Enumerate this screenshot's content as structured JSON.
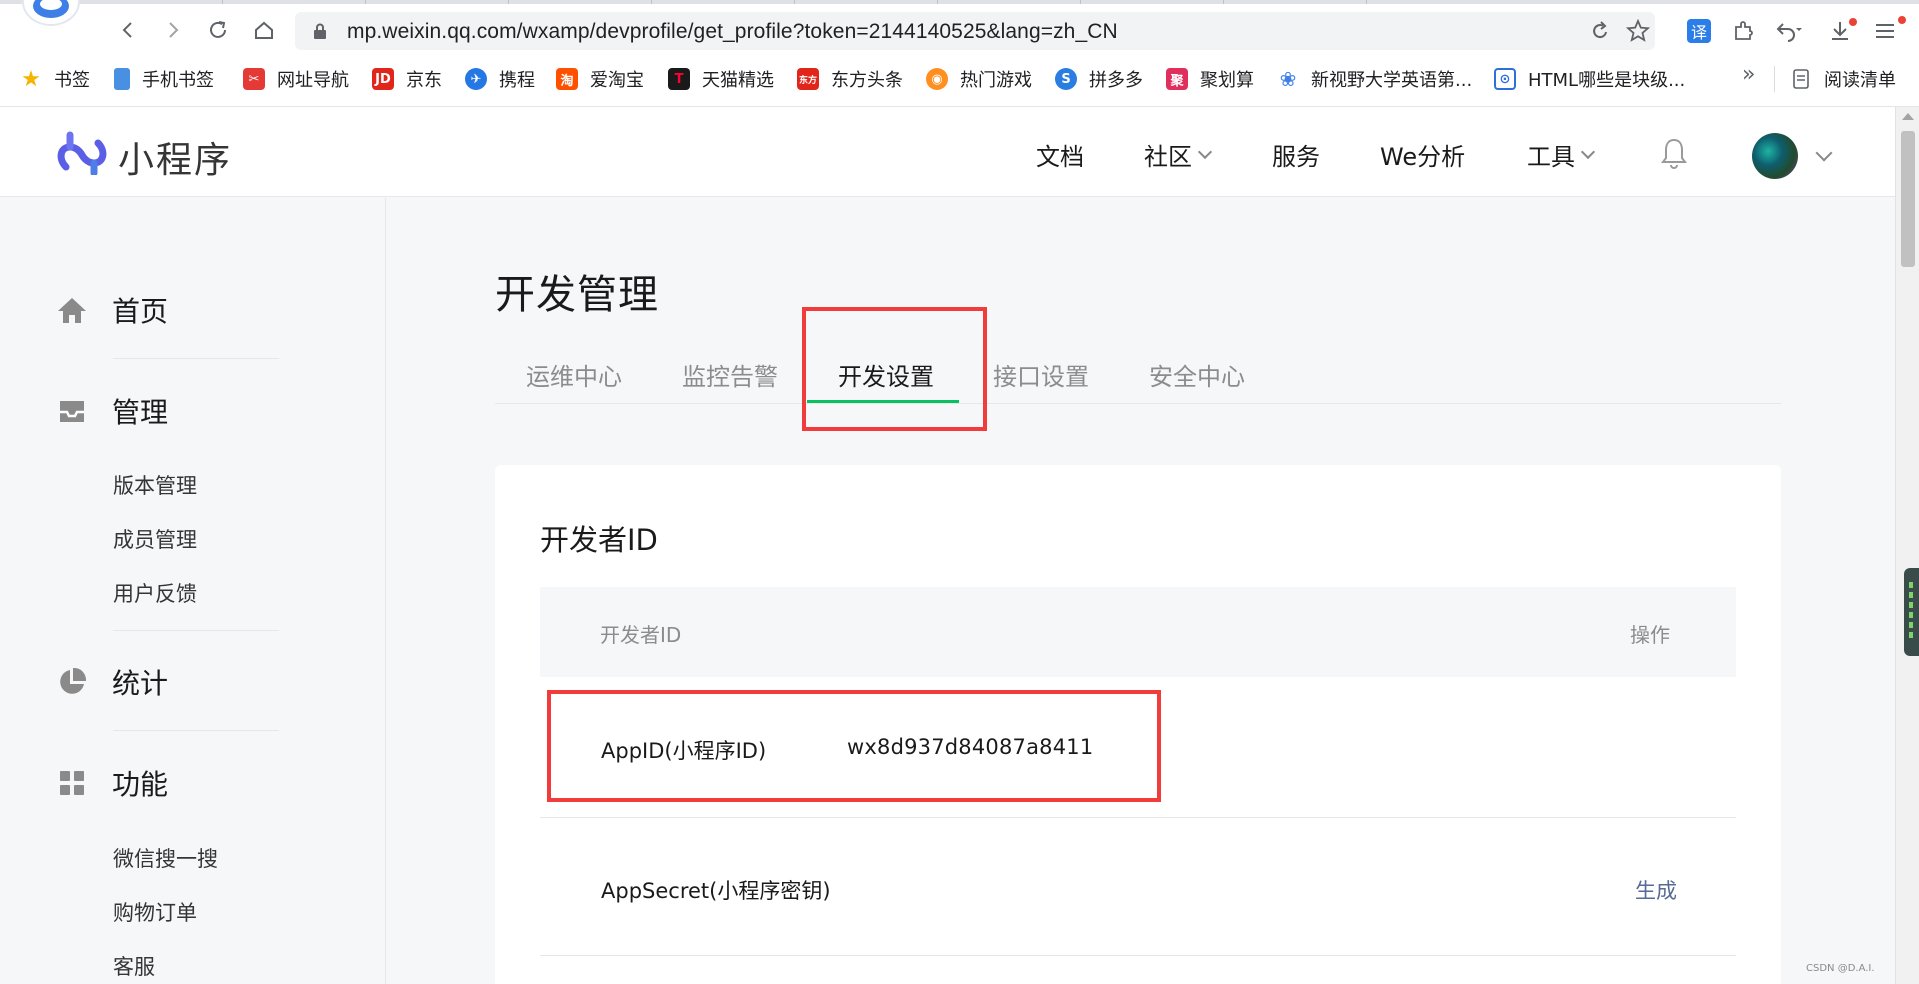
{
  "browser": {
    "url": "mp.weixin.qq.com/wxamp/devprofile/get_profile?token=2144140525&lang=zh_CN",
    "translate_label": "译",
    "bookmarks": [
      {
        "label": "书签",
        "icon": "star-icon",
        "color": "#f4b400"
      },
      {
        "label": "手机书签",
        "icon": "phone-icon",
        "color": "#4a90e2"
      },
      {
        "label": "网址导航",
        "icon": "nav-icon",
        "color": "#e53935"
      },
      {
        "label": "京东",
        "icon": "jd-icon",
        "color": "#e1251b"
      },
      {
        "label": "携程",
        "icon": "ctrip-icon",
        "color": "#2577e3"
      },
      {
        "label": "爱淘宝",
        "icon": "taobao-icon",
        "color": "#ff5000"
      },
      {
        "label": "天猫精选",
        "icon": "tmall-icon",
        "color": "#1a1a1a"
      },
      {
        "label": "东方头条",
        "icon": "toutiao-icon",
        "color": "#e1251b"
      },
      {
        "label": "热门游戏",
        "icon": "game-icon",
        "color": "#ff8f1f"
      },
      {
        "label": "拼多多",
        "icon": "pdd-icon",
        "color": "#2a7de1"
      },
      {
        "label": "聚划算",
        "icon": "juhuasuan-icon",
        "color": "#e02e5d"
      },
      {
        "label": "新视野大学英语第...",
        "icon": "paw-icon",
        "color": "#3f7fe6"
      },
      {
        "label": "HTML哪些是块级...",
        "icon": "html-icon",
        "color": "#2f6fdb"
      }
    ],
    "more_label": "»",
    "reading_list_label": "阅读清单"
  },
  "site": {
    "name": "小程序",
    "nav": [
      {
        "label": "文档",
        "has_dropdown": false
      },
      {
        "label": "社区",
        "has_dropdown": true
      },
      {
        "label": "服务",
        "has_dropdown": false
      },
      {
        "label": "We分析",
        "has_dropdown": false
      },
      {
        "label": "工具",
        "has_dropdown": true
      }
    ]
  },
  "sidebar": {
    "home": "首页",
    "manage": "管理",
    "manage_items": [
      "版本管理",
      "成员管理",
      "用户反馈"
    ],
    "stats": "统计",
    "features": "功能",
    "feature_items": [
      "微信搜一搜",
      "购物订单",
      "客服"
    ]
  },
  "main": {
    "title": "开发管理",
    "tabs": [
      {
        "label": "运维中心",
        "active": false
      },
      {
        "label": "监控告警",
        "active": false
      },
      {
        "label": "开发设置",
        "active": true
      },
      {
        "label": "接口设置",
        "active": false
      },
      {
        "label": "安全中心",
        "active": false
      }
    ],
    "card_title": "开发者ID",
    "table_headers": {
      "id": "开发者ID",
      "action": "操作"
    },
    "rows": [
      {
        "name": "AppID(小程序ID)",
        "value": "wx8d937d84087a8411",
        "action": ""
      },
      {
        "name": "AppSecret(小程序密钥)",
        "value": "",
        "action": "生成"
      }
    ]
  },
  "colors": {
    "accent_green": "#07c160",
    "highlight_red": "#f23b3b",
    "link_blue": "#576b95"
  },
  "watermark": "CSDN @D.A.I."
}
